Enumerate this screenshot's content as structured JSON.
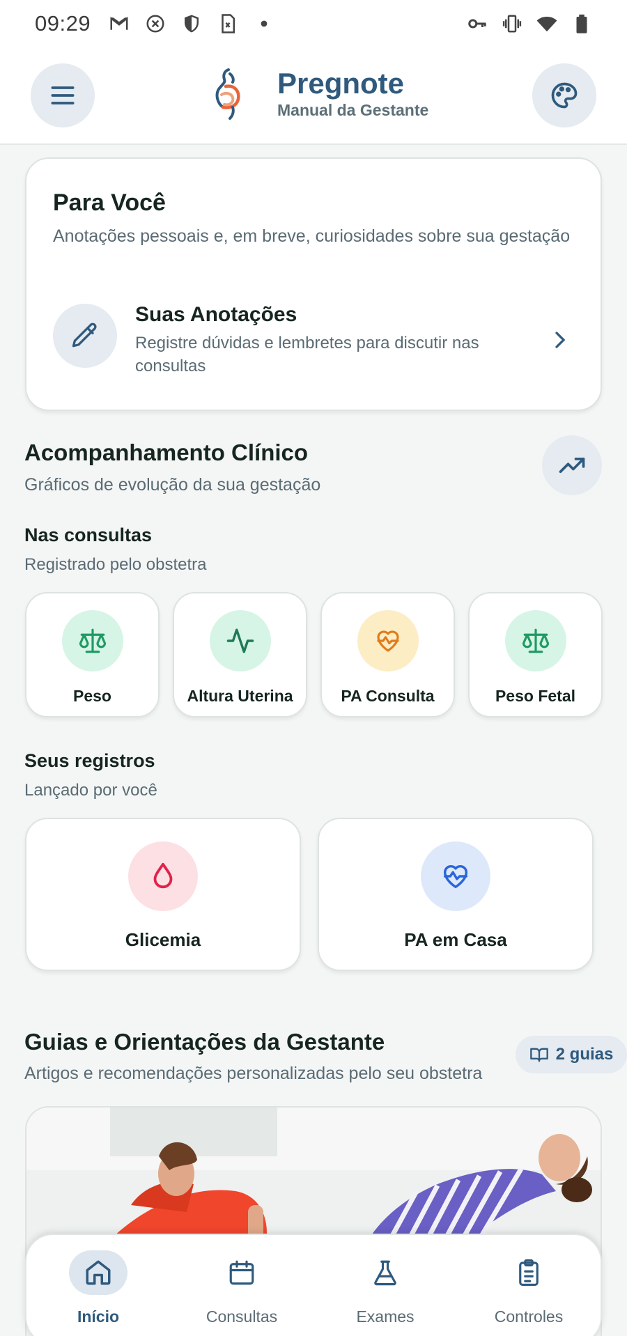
{
  "status_bar": {
    "time": "09:29",
    "icons_left": [
      "gmail-icon",
      "blocked-icon",
      "shield-icon",
      "sim-icon",
      "dot-icon"
    ],
    "icons_right": [
      "vpn-key-icon",
      "vibrate-icon",
      "wifi-icon",
      "battery-icon"
    ]
  },
  "header": {
    "app_name": "Pregnote",
    "subtitle": "Manual da Gestante"
  },
  "para_voce": {
    "title": "Para Você",
    "subtitle": "Anotações pessoais e, em breve, curiosidades sobre sua gestação",
    "notes": {
      "title": "Suas Anotações",
      "description": "Registre dúvidas e lembretes para discutir nas consultas"
    }
  },
  "clinico": {
    "title": "Acompanhamento Clínico",
    "subtitle": "Gráficos de evolução da sua gestação"
  },
  "consultas": {
    "title": "Nas consultas",
    "subtitle": "Registrado pelo obstetra",
    "tiles": [
      {
        "label": "Peso",
        "icon": "scale-icon",
        "bg": "#d6f5e6",
        "color": "#1f9a63"
      },
      {
        "label": "Altura Uterina",
        "icon": "activity-icon",
        "bg": "#d6f5e6",
        "color": "#1f7a57"
      },
      {
        "label": "PA Consulta",
        "icon": "heart-pulse-icon",
        "bg": "#fcedc4",
        "color": "#e07b1a"
      },
      {
        "label": "Peso Fetal",
        "icon": "scale-icon",
        "bg": "#d6f5e6",
        "color": "#1f9a63"
      }
    ]
  },
  "registros": {
    "title": "Seus registros",
    "subtitle": "Lançado por você",
    "tiles": [
      {
        "label": "Glicemia",
        "icon": "drop-icon",
        "bg": "#fde0e4",
        "color": "#e0234a"
      },
      {
        "label": "PA em Casa",
        "icon": "heart-pulse-icon",
        "bg": "#dde9fb",
        "color": "#2a66d9"
      }
    ]
  },
  "guias": {
    "title": "Guias e Orientações da Gestante",
    "subtitle": "Artigos e recomendações personalizadas pelo seu obstetra",
    "badge": "2 guias"
  },
  "bottom_nav": {
    "items": [
      {
        "label": "Início",
        "icon": "home-icon",
        "active": true
      },
      {
        "label": "Consultas",
        "icon": "calendar-icon",
        "active": false
      },
      {
        "label": "Exames",
        "icon": "flask-icon",
        "active": false
      },
      {
        "label": "Controles",
        "icon": "clipboard-icon",
        "active": false
      }
    ]
  },
  "colors": {
    "brand": "#2f5a7e",
    "background": "#f4f6f5"
  }
}
